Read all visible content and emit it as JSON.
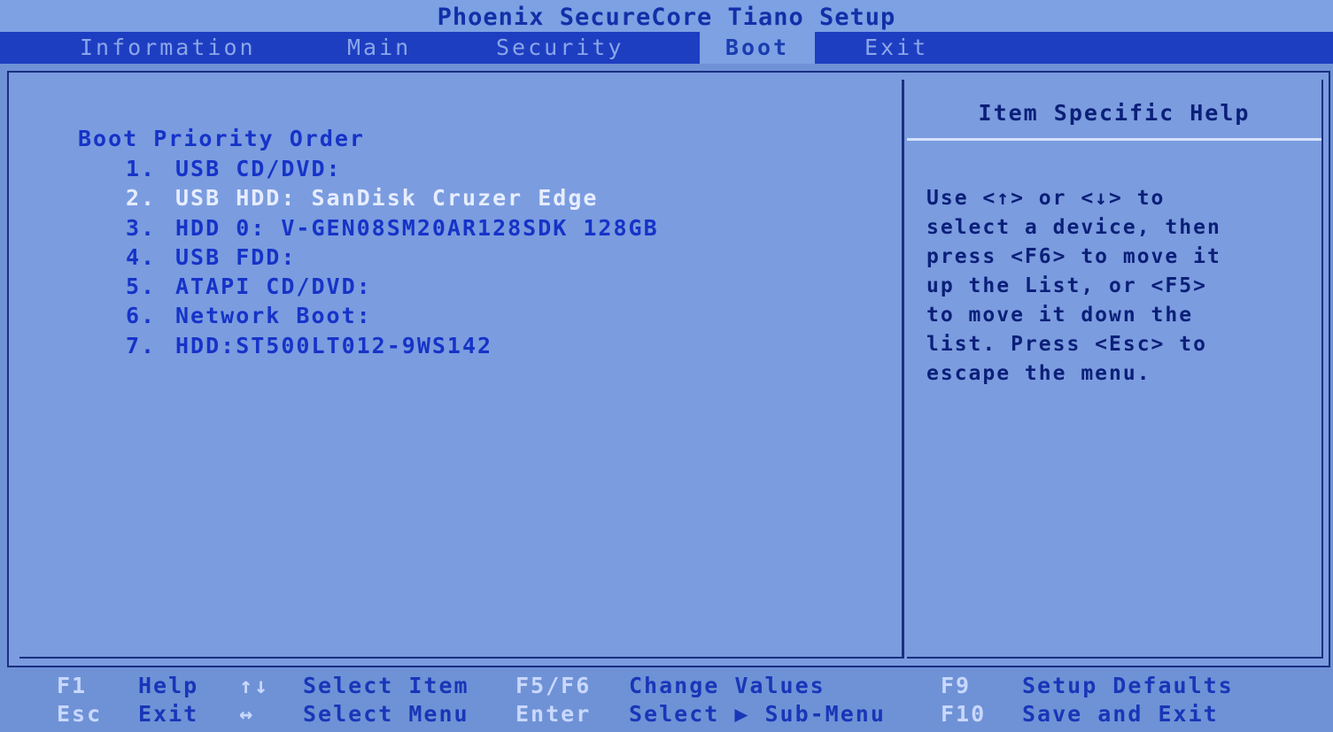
{
  "app": {
    "title": "Phoenix SecureCore Tiano Setup"
  },
  "tabs": [
    {
      "label": "Information",
      "active": false
    },
    {
      "label": "Main",
      "active": false
    },
    {
      "label": "Security",
      "active": false
    },
    {
      "label": "Boot",
      "active": true
    },
    {
      "label": "Exit",
      "active": false
    }
  ],
  "boot": {
    "section_title": "Boot Priority Order",
    "items": [
      {
        "num": "1.",
        "label": "USB CD/DVD:"
      },
      {
        "num": "2.",
        "label": "USB HDD: SanDisk Cruzer Edge"
      },
      {
        "num": "3.",
        "label": "HDD 0: V-GEN08SM20AR128SDK 128GB"
      },
      {
        "num": "4.",
        "label": "USB FDD:"
      },
      {
        "num": "5.",
        "label": "ATAPI CD/DVD:"
      },
      {
        "num": "6.",
        "label": "Network Boot:"
      },
      {
        "num": "7.",
        "label": "HDD:ST500LT012-9WS142"
      }
    ],
    "selected_index": 1
  },
  "help": {
    "title": "Item Specific Help",
    "text": "Use <↑> or <↓> to\nselect a device, then\npress <F6> to move it\nup the List, or <F5>\nto move it down the\nlist. Press <Esc> to\nescape the menu."
  },
  "footer": {
    "f1": {
      "key": "F1",
      "desc": "Help"
    },
    "esc": {
      "key": "Esc",
      "desc": "Exit"
    },
    "updown": {
      "key": "↑↓",
      "desc": "Select Item"
    },
    "leftright": {
      "key": "↔",
      "desc": "Select Menu"
    },
    "f5f6": {
      "key": "F5/F6",
      "desc": "Change Values"
    },
    "enter": {
      "key": "Enter",
      "desc": "Select ▶ Sub-Menu"
    },
    "f9": {
      "key": "F9",
      "desc": "Setup Defaults"
    },
    "f10": {
      "key": "F10",
      "desc": "Save and Exit"
    }
  },
  "colors": {
    "background": "#6f92d6",
    "menu_bar": "#1e3ec2",
    "active_tab": "#7da1e3",
    "text_blue": "#1633c8",
    "highlight_text": "#e6edff"
  }
}
